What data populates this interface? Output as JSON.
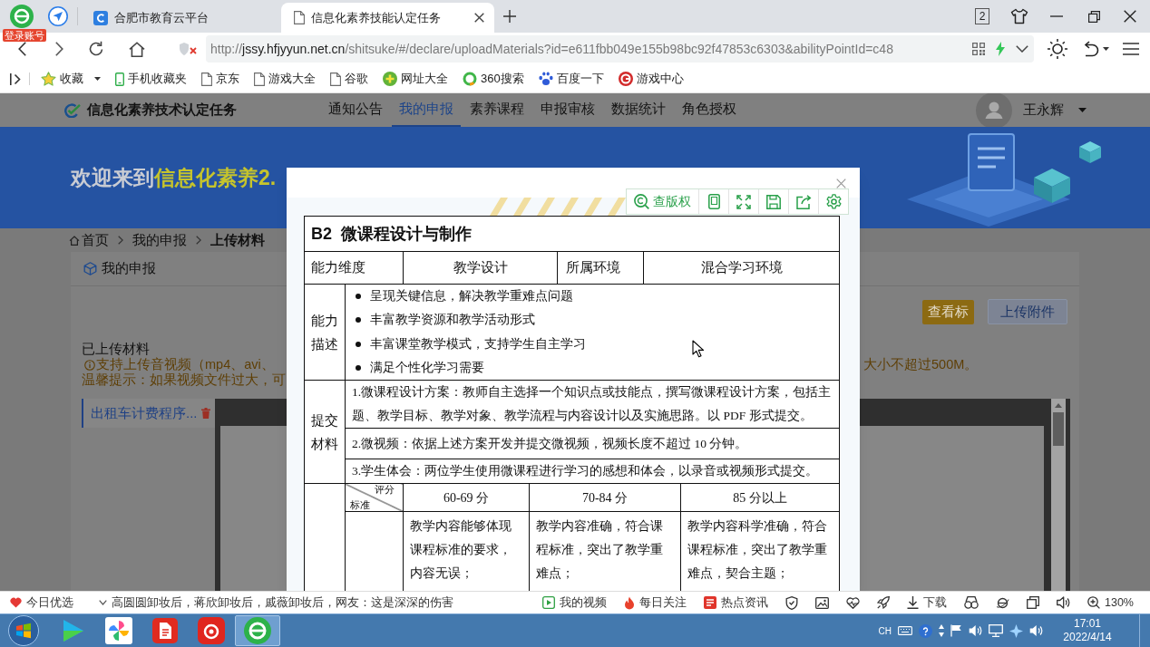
{
  "browser": {
    "login_badge": "登录账号",
    "tabs": [
      {
        "kind": "site",
        "title": "合肥市教育云平台",
        "selected": false
      },
      {
        "kind": "page",
        "title": "信息化素养技能认定任务",
        "selected": true
      }
    ],
    "window_count": "2",
    "address": {
      "scheme": "http://",
      "host": "jssy.hfjyyun.net.cn",
      "path": "/shitsuke/#/declare/uploadMaterials?id=e611fbb049e155b98bc92f47853c6303&abilityPointId=c48"
    },
    "bookmarks": [
      {
        "kind": "star",
        "label": "收藏",
        "dropdown": true
      },
      {
        "kind": "phone",
        "label": "手机收藏夹",
        "dropdown": false
      },
      {
        "kind": "page",
        "label": "京东",
        "dropdown": false
      },
      {
        "kind": "page",
        "label": "游戏大全",
        "dropdown": false
      },
      {
        "kind": "page",
        "label": "谷歌",
        "dropdown": false
      },
      {
        "kind": "plus",
        "label": "网址大全",
        "dropdown": false
      },
      {
        "kind": "ring",
        "label": "360搜索",
        "dropdown": false
      },
      {
        "kind": "paw",
        "label": "百度一下",
        "dropdown": false
      },
      {
        "kind": "game",
        "label": "游戏中心",
        "dropdown": false
      }
    ]
  },
  "site": {
    "logo": "信息化素养技术认定任务",
    "nav": [
      {
        "label": "通知公告",
        "selected": false
      },
      {
        "label": "我的申报",
        "selected": true
      },
      {
        "label": "素养课程",
        "selected": false
      },
      {
        "label": "申报审核",
        "selected": false
      },
      {
        "label": "数据统计",
        "selected": false
      },
      {
        "label": "角色授权",
        "selected": false
      }
    ],
    "user_name": "王永辉"
  },
  "banner": {
    "lead": "欢迎来到",
    "highlight": "信息化素养2."
  },
  "breadcrumb": [
    {
      "label": "首页",
      "current": false
    },
    {
      "label": "我的申报",
      "current": false
    },
    {
      "label": "上传材料",
      "current": true
    }
  ],
  "panel": {
    "title": "我的申报",
    "buttons": [
      {
        "kind": "primary",
        "label": "查看标"
      },
      {
        "kind": "secondary",
        "label": "上传附件"
      }
    ],
    "section_title": "已上传材料",
    "notice_left": "支持上传音视频（mp4、avi、",
    "notice_right": "大小不超过500M。",
    "hint": "温馨提示：如果视频文件过大，可",
    "files": [
      {
        "name": "出租车计费程序...",
        "selected": true
      }
    ]
  },
  "modal": {
    "toolbar": [
      {
        "kind": "copyright",
        "label": "查版权"
      },
      {
        "kind": "phone"
      },
      {
        "kind": "fullscreen"
      },
      {
        "kind": "save"
      },
      {
        "kind": "share"
      },
      {
        "kind": "settings"
      }
    ],
    "document": {
      "title": "B2  微课程设计与制作",
      "fields": [
        {
          "label": "能力维度",
          "value": "教学设计"
        },
        {
          "label": "所属环境",
          "value": "混合学习环境"
        }
      ],
      "description": {
        "label": "能力描述",
        "items": [
          "呈现关键信息，解决教学重难点问题",
          "丰富教学资源和教学活动形式",
          "丰富课堂教学模式，支持学生自主学习",
          "满足个性化学习需要"
        ]
      },
      "materials": {
        "label": "提交材料",
        "items": [
          "1.微课程设计方案：教师自主选择一个知识点或技能点，撰写微课程设计方案，包括主题、教学目标、教学对象、教学流程与内容设计以及实施思路。以 PDF 形式提交。",
          "2.微视频：依据上述方案开发并提交微视频，视频长度不超过 10 分钟。",
          "3.学生体会：两位学生使用微课程进行学习的感想和体会，以录音或视频形式提交。"
        ]
      },
      "scoring": {
        "corner_top": "评分",
        "corner_bottom": "标准",
        "levels": [
          "60-69 分",
          "70-84 分",
          "85 分以上"
        ],
        "criteria": [
          "教学内容能够体现课程标准的要求，内容无误；",
          "教学内容准确，符合课程标准，突出了教学重难点；",
          "教学内容科学准确，符合课程标准，突出了教学重难点，契合主题；"
        ]
      }
    }
  },
  "status_bar": {
    "left": [
      {
        "kind": "heart",
        "label": "今日优选"
      },
      {
        "kind": "headline",
        "label": "高圆圆卸妆后，蒋欣卸妆后，戚薇卸妆后，网友：这是深深的伤害"
      }
    ],
    "right": [
      {
        "kind": "video",
        "label": "我的视频"
      },
      {
        "kind": "flame",
        "label": "每日关注"
      },
      {
        "kind": "news",
        "label": "热点资讯"
      },
      {
        "kind": "shield"
      },
      {
        "kind": "image"
      },
      {
        "kind": "health"
      },
      {
        "kind": "rocket"
      },
      {
        "kind": "download",
        "label": "下载"
      },
      {
        "kind": "glasses"
      },
      {
        "kind": "browser"
      },
      {
        "kind": "window"
      },
      {
        "kind": "sound"
      },
      {
        "kind": "zoom",
        "label": "130%"
      }
    ]
  },
  "taskbar": {
    "apps": [
      {
        "kind": "video",
        "selected": false
      },
      {
        "kind": "pinwheel",
        "selected": false
      },
      {
        "kind": "office",
        "selected": false
      },
      {
        "kind": "music",
        "selected": false
      },
      {
        "kind": "browser",
        "selected": true
      }
    ],
    "language": "CH",
    "time": "17:01",
    "date": "2022/4/14"
  }
}
